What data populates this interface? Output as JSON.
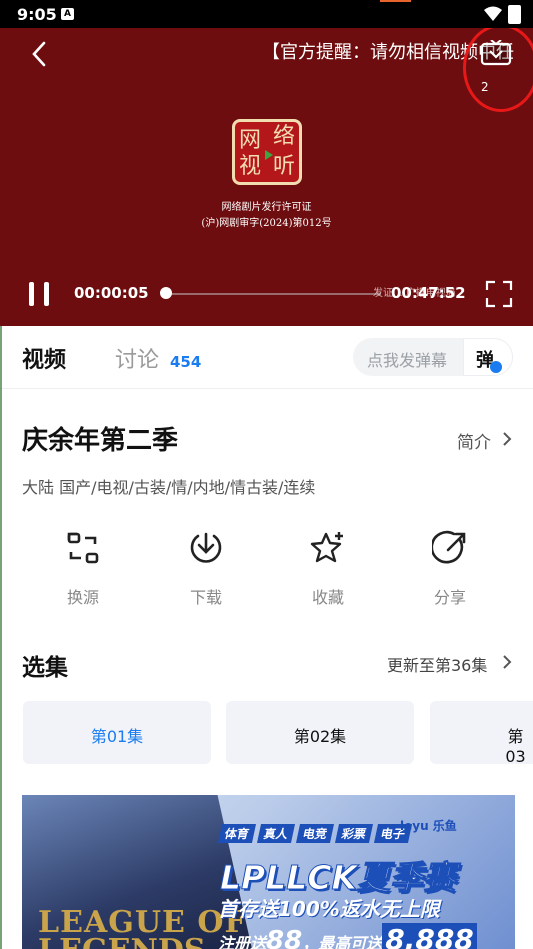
{
  "status_bar": {
    "time": "9:05",
    "notification_icon": "A"
  },
  "player": {
    "notice": "【官方提醒：请勿相信视频中任",
    "overlay_char": "2",
    "seal_chars": [
      "网",
      "络",
      "视",
      "听"
    ],
    "license_line1": "网络剧片发行许可证",
    "license_line2": "(沪)网剧审字(2024)第012号",
    "current_time": "00:00:05",
    "total_time": "00:47:52",
    "seek_caption": "发证... 广播电视局",
    "progress_fraction": 0.01
  },
  "tabs": {
    "video": "视频",
    "discuss": "讨论",
    "discuss_count": "454",
    "danmu_placeholder": "点我发弹幕",
    "danmu_button": "弹"
  },
  "show": {
    "title": "庆余年第二季",
    "intro": "简介",
    "tags": "大陆  国产/电视/古装/情/内地/情古装/连续"
  },
  "actions": [
    {
      "label": "换源",
      "icon": "switch-source-icon"
    },
    {
      "label": "下载",
      "icon": "download-icon"
    },
    {
      "label": "收藏",
      "icon": "favorite-star-icon"
    },
    {
      "label": "分享",
      "icon": "share-icon"
    }
  ],
  "episodes": {
    "section_title": "选集",
    "update_text": "更新至第36集",
    "items": [
      "第01集",
      "第02集",
      "第03"
    ],
    "selected_index": 0
  },
  "banner": {
    "pills": [
      "体育",
      "真人",
      "电竞",
      "彩票",
      "电子"
    ],
    "brand": "leyu 乐鱼",
    "headline": "LPLLCK夏季赛",
    "sub": "首存送100%返水无上限",
    "bottom_prefix": "注册送",
    "bottom_num1": "88",
    "bottom_mid": "，最高可送",
    "bottom_num2": "8,888",
    "game_line1": "LEAGUE OF",
    "game_line2": "LEGENDS"
  },
  "colors": {
    "accent": "#1a7cf0",
    "player_bg": "#6e0d0f",
    "annotation": "#e81818"
  }
}
